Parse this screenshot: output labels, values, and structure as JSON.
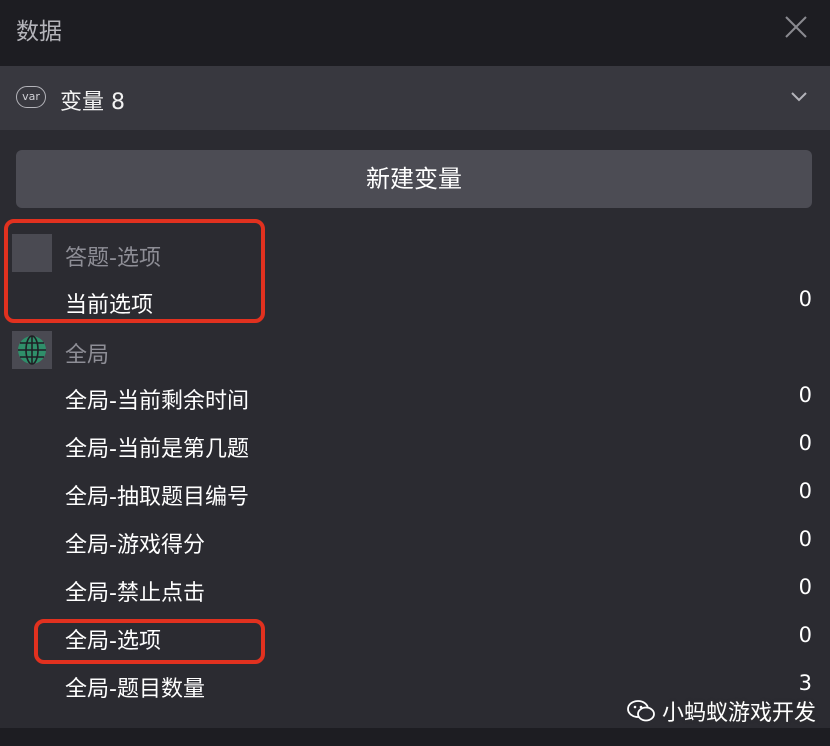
{
  "panel": {
    "title": "数据",
    "close_icon": "close-icon"
  },
  "section": {
    "badge": "var",
    "label": "变量 8"
  },
  "new_variable_button": "新建变量",
  "groups": [
    {
      "title": "答题-选项",
      "icon": "blank-square-icon",
      "variables": [
        {
          "name": "当前选项",
          "value": "0"
        }
      ]
    },
    {
      "title": "全局",
      "icon": "globe-icon",
      "variables": [
        {
          "name": "全局-当前剩余时间",
          "value": "0"
        },
        {
          "name": "全局-当前是第几题",
          "value": "0"
        },
        {
          "name": "全局-抽取题目编号",
          "value": "0"
        },
        {
          "name": "全局-游戏得分",
          "value": "0"
        },
        {
          "name": "全局-禁止点击",
          "value": "0"
        },
        {
          "name": "全局-选项",
          "value": "0"
        },
        {
          "name": "全局-题目数量",
          "value": "3"
        }
      ]
    }
  ],
  "watermark": "小蚂蚁游戏开发",
  "colors": {
    "highlight": "#e1311f",
    "globe": "#2f8f6a"
  }
}
